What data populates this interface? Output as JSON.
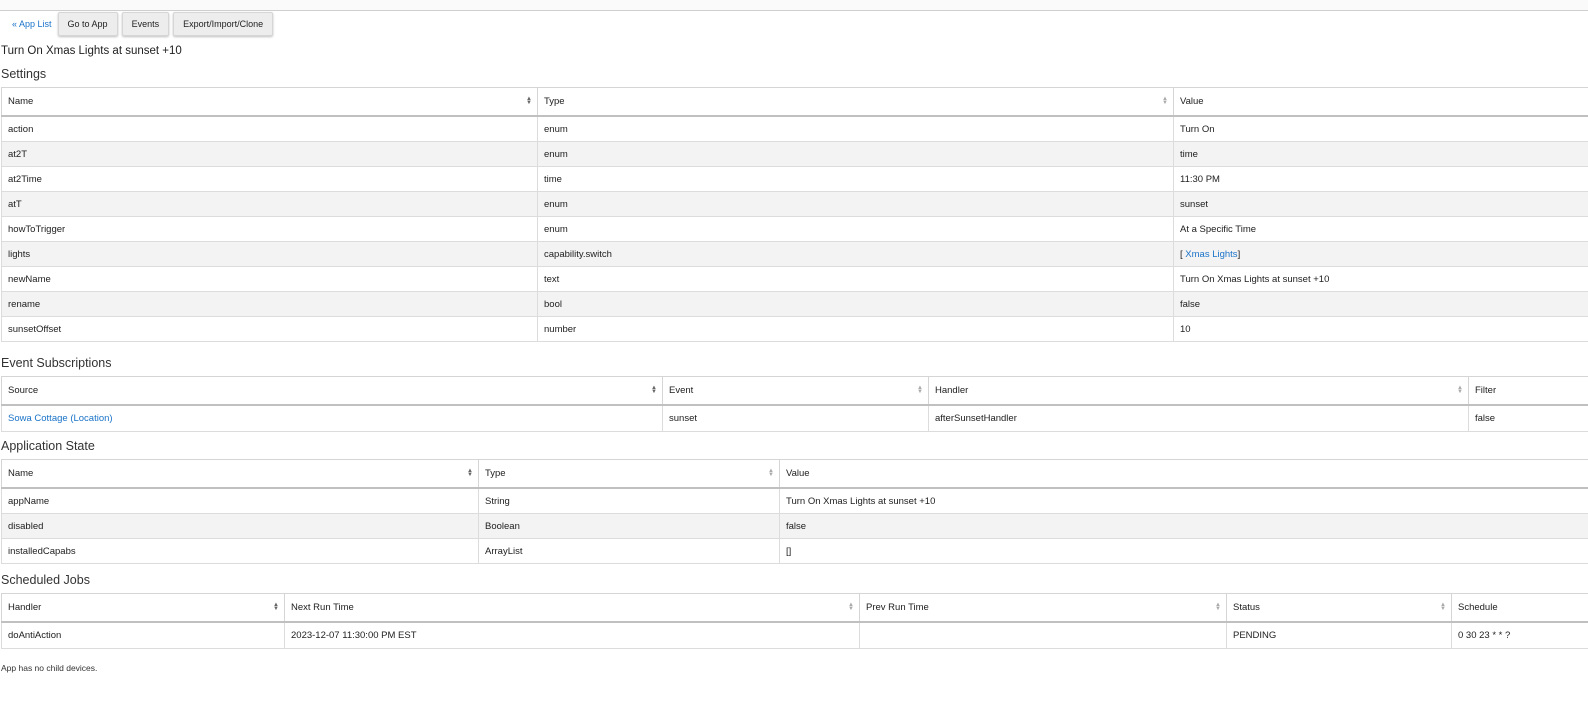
{
  "toolbar": {
    "app_list_label": "« App List",
    "go_to_app_label": "Go to App",
    "events_label": "Events",
    "export_label": "Export/Import/Clone"
  },
  "app_title": "Turn On Xmas Lights at sunset +10",
  "settings": {
    "title": "Settings",
    "headers": [
      "Name",
      "Type",
      "Value"
    ],
    "rows": [
      {
        "name": "action",
        "type": "enum",
        "value": "Turn On"
      },
      {
        "name": "at2T",
        "type": "enum",
        "value": "time"
      },
      {
        "name": "at2Time",
        "type": "time",
        "value": "11:30 PM"
      },
      {
        "name": "atT",
        "type": "enum",
        "value": "sunset"
      },
      {
        "name": "howToTrigger",
        "type": "enum",
        "value": "At a Specific Time"
      },
      {
        "name": "lights",
        "type": "capability.switch",
        "value_prefix": "[",
        "value_link": "Xmas Lights",
        "value_suffix": "]"
      },
      {
        "name": "newName",
        "type": "text",
        "value": "Turn On Xmas Lights at sunset +10"
      },
      {
        "name": "rename",
        "type": "bool",
        "value": "false"
      },
      {
        "name": "sunsetOffset",
        "type": "number",
        "value": "10"
      }
    ]
  },
  "subscriptions": {
    "title": "Event Subscriptions",
    "headers": [
      "Source",
      "Event",
      "Handler",
      "Filter"
    ],
    "rows": [
      {
        "source": "Sowa Cottage (Location)",
        "event": "sunset",
        "handler": "afterSunsetHandler",
        "filter": "false"
      }
    ]
  },
  "state": {
    "title": "Application State",
    "headers": [
      "Name",
      "Type",
      "Value"
    ],
    "rows": [
      {
        "name": "appName",
        "type": "String",
        "value": "Turn On Xmas Lights at sunset +10"
      },
      {
        "name": "disabled",
        "type": "Boolean",
        "value": "false"
      },
      {
        "name": "installedCapabs",
        "type": "ArrayList",
        "value": "[]"
      }
    ]
  },
  "jobs": {
    "title": "Scheduled Jobs",
    "headers": [
      "Handler",
      "Next Run Time",
      "Prev Run Time",
      "Status",
      "Schedule"
    ],
    "rows": [
      {
        "handler": "doAntiAction",
        "next": "2023-12-07 11:30:00 PM EST",
        "prev": "",
        "status": "PENDING",
        "schedule": "0 30 23 * * ?"
      }
    ]
  },
  "footer": "App has no child devices.",
  "colors": {
    "link": "#1a73c8",
    "alt_row": "#f3f3f3"
  }
}
